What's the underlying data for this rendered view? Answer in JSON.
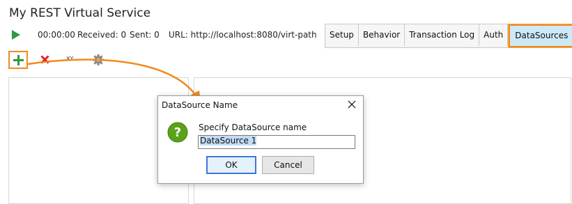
{
  "window": {
    "title": "My REST Virtual Service"
  },
  "status": {
    "time": "00:00:00",
    "received": "Received: 0",
    "sent": "Sent: 0",
    "url": "URL: http://localhost:8080/virt-path"
  },
  "tabs": [
    {
      "label": "Setup",
      "active": false
    },
    {
      "label": "Behavior",
      "active": false
    },
    {
      "label": "Transaction Log",
      "active": false
    },
    {
      "label": "Auth",
      "active": false
    },
    {
      "label": "DataSources",
      "active": true
    }
  ],
  "toolbar": {
    "add_icon": "plus-icon",
    "delete_icon": "close-icon",
    "variables_label": "XY..",
    "settings_icon": "gear-icon"
  },
  "dialog": {
    "title": "DataSource Name",
    "prompt": "Specify DataSource name",
    "input_value": "DataSource 1",
    "ok_label": "OK",
    "cancel_label": "Cancel",
    "icon": "question-icon"
  },
  "colors": {
    "accent_orange": "#f28a1b",
    "active_tab": "#cde8f6",
    "add_green": "#2e9a3e",
    "delete_red": "#e0212b",
    "question_green": "#5aa317"
  }
}
